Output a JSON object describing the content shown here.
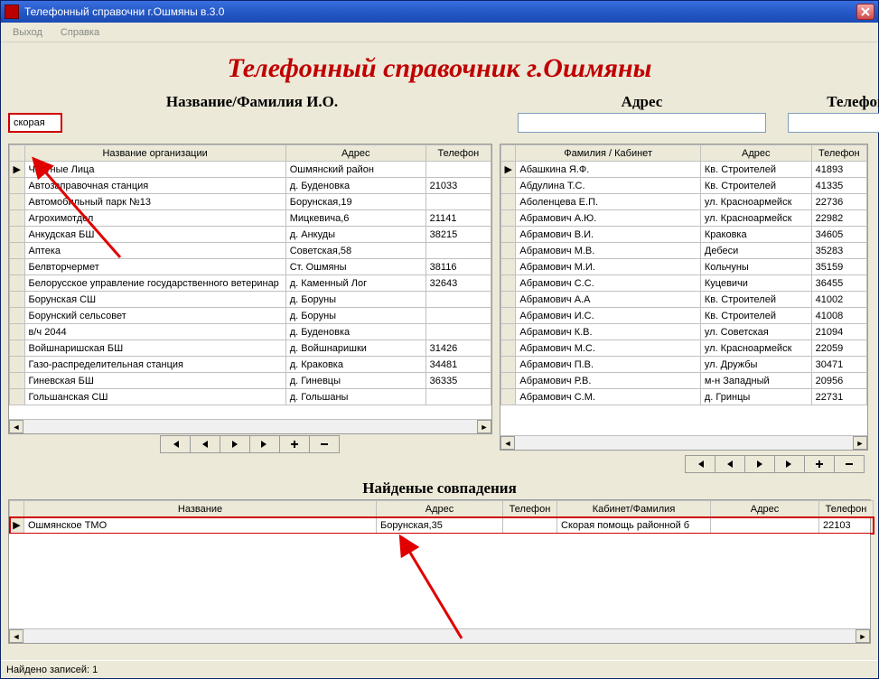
{
  "window": {
    "title": "Телефонный справочни г.Ошмяны в.3.0"
  },
  "menu": {
    "exit": "Выход",
    "help": "Справка"
  },
  "banner": "Телефонный справочник г.Ошмяны",
  "search": {
    "name_label": "Название/Фамилия И.О.",
    "addr_label": "Адрес",
    "tel_label": "Телефон",
    "name_value": "скорая",
    "addr_value": "",
    "tel_value": ""
  },
  "left_grid": {
    "headers": {
      "org": "Название организации",
      "addr": "Адрес",
      "tel": "Телефон"
    },
    "rows": [
      {
        "sel": true,
        "org": "Частные Лица",
        "addr": "Ошмянский район",
        "tel": ""
      },
      {
        "sel": false,
        "org": "Автозаправочная станция",
        "addr": "д. Буденовка",
        "tel": "21033"
      },
      {
        "sel": false,
        "org": "Автомобильный парк №13",
        "addr": "Борунская,19",
        "tel": ""
      },
      {
        "sel": false,
        "org": "Агрохимотдел",
        "addr": "Мицкевича,6",
        "tel": "21141"
      },
      {
        "sel": false,
        "org": "Анкудская БШ",
        "addr": "д. Анкуды",
        "tel": "38215"
      },
      {
        "sel": false,
        "org": "Аптека",
        "addr": "Советская,58",
        "tel": ""
      },
      {
        "sel": false,
        "org": "Белвторчермет",
        "addr": "Ст. Ошмяны",
        "tel": "38116"
      },
      {
        "sel": false,
        "org": "Белорусское управление государственного ветеринар",
        "addr": "д. Каменный Лог",
        "tel": "32643"
      },
      {
        "sel": false,
        "org": "Борунская СШ",
        "addr": "д. Боруны",
        "tel": ""
      },
      {
        "sel": false,
        "org": "Борунский сельсовет",
        "addr": "д. Боруны",
        "tel": ""
      },
      {
        "sel": false,
        "org": "в/ч 2044",
        "addr": "д. Буденовка",
        "tel": ""
      },
      {
        "sel": false,
        "org": "Войшнаришская БШ",
        "addr": "д. Войшнаришки",
        "tel": "31426"
      },
      {
        "sel": false,
        "org": "Газо-распределительная станция",
        "addr": "д. Краковка",
        "tel": "34481"
      },
      {
        "sel": false,
        "org": "Гиневская БШ",
        "addr": "д. Гиневцы",
        "tel": "36335"
      },
      {
        "sel": false,
        "org": "Гольшанская СШ",
        "addr": "д. Гольшаны",
        "tel": ""
      }
    ]
  },
  "right_grid": {
    "headers": {
      "fam": "Фамилия / Кабинет",
      "addr": "Адрес",
      "tel": "Телефон"
    },
    "rows": [
      {
        "sel": true,
        "fam": "Абашкина Я.Ф.",
        "addr": "Кв. Строителей",
        "tel": "41893"
      },
      {
        "sel": false,
        "fam": "Абдулина Т.С.",
        "addr": "Кв. Строителей",
        "tel": "41335"
      },
      {
        "sel": false,
        "fam": "Аболенцева Е.П.",
        "addr": "ул. Красноармейск",
        "tel": "22736"
      },
      {
        "sel": false,
        "fam": "Абрамович  А.Ю.",
        "addr": "ул. Красноармейск",
        "tel": "22982"
      },
      {
        "sel": false,
        "fam": "Абрамович  В.И.",
        "addr": "Краковка",
        "tel": "34605"
      },
      {
        "sel": false,
        "fam": "Абрамович  М.В.",
        "addr": "Дебеси",
        "tel": "35283"
      },
      {
        "sel": false,
        "fam": "Абрамович  М.И.",
        "addr": "Кольчуны",
        "tel": "35159"
      },
      {
        "sel": false,
        "fam": "Абрамович  С.С.",
        "addr": "Куцевичи",
        "tel": "36455"
      },
      {
        "sel": false,
        "fam": "Абрамович А.А",
        "addr": "Кв. Строителей",
        "tel": "41002"
      },
      {
        "sel": false,
        "fam": "Абрамович И.С.",
        "addr": "Кв. Строителей",
        "tel": "41008"
      },
      {
        "sel": false,
        "fam": "Абрамович К.В.",
        "addr": "ул. Советская",
        "tel": "21094"
      },
      {
        "sel": false,
        "fam": "Абрамович М.С.",
        "addr": "ул. Красноармейск",
        "tel": "22059"
      },
      {
        "sel": false,
        "fam": "Абрамович П.В.",
        "addr": "ул. Дружбы",
        "tel": "30471"
      },
      {
        "sel": false,
        "fam": "Абрамович Р.В.",
        "addr": "м-н Западный",
        "tel": "20956"
      },
      {
        "sel": false,
        "fam": "Абрамович С.М.",
        "addr": "д. Гринцы",
        "tel": "22731"
      }
    ]
  },
  "matches": {
    "title": "Найденые совпадения",
    "headers": {
      "name": "Название",
      "addr": "Адрес",
      "tel": "Телефон",
      "cab": "Кабинет/Фамилия",
      "addr2": "Адрес",
      "tel2": "Телефон"
    },
    "rows": [
      {
        "sel": true,
        "name": "Ошмянское ТМО",
        "addr": "Борунская,35",
        "tel": "",
        "cab": "Скорая помощь районной б",
        "addr2": "",
        "tel2": "22103"
      }
    ]
  },
  "status": "Найдено записей: 1",
  "nav": {
    "first": "⏮",
    "prev": "◄",
    "next": "►",
    "last": "⏭",
    "add": "✚",
    "del": "━"
  }
}
